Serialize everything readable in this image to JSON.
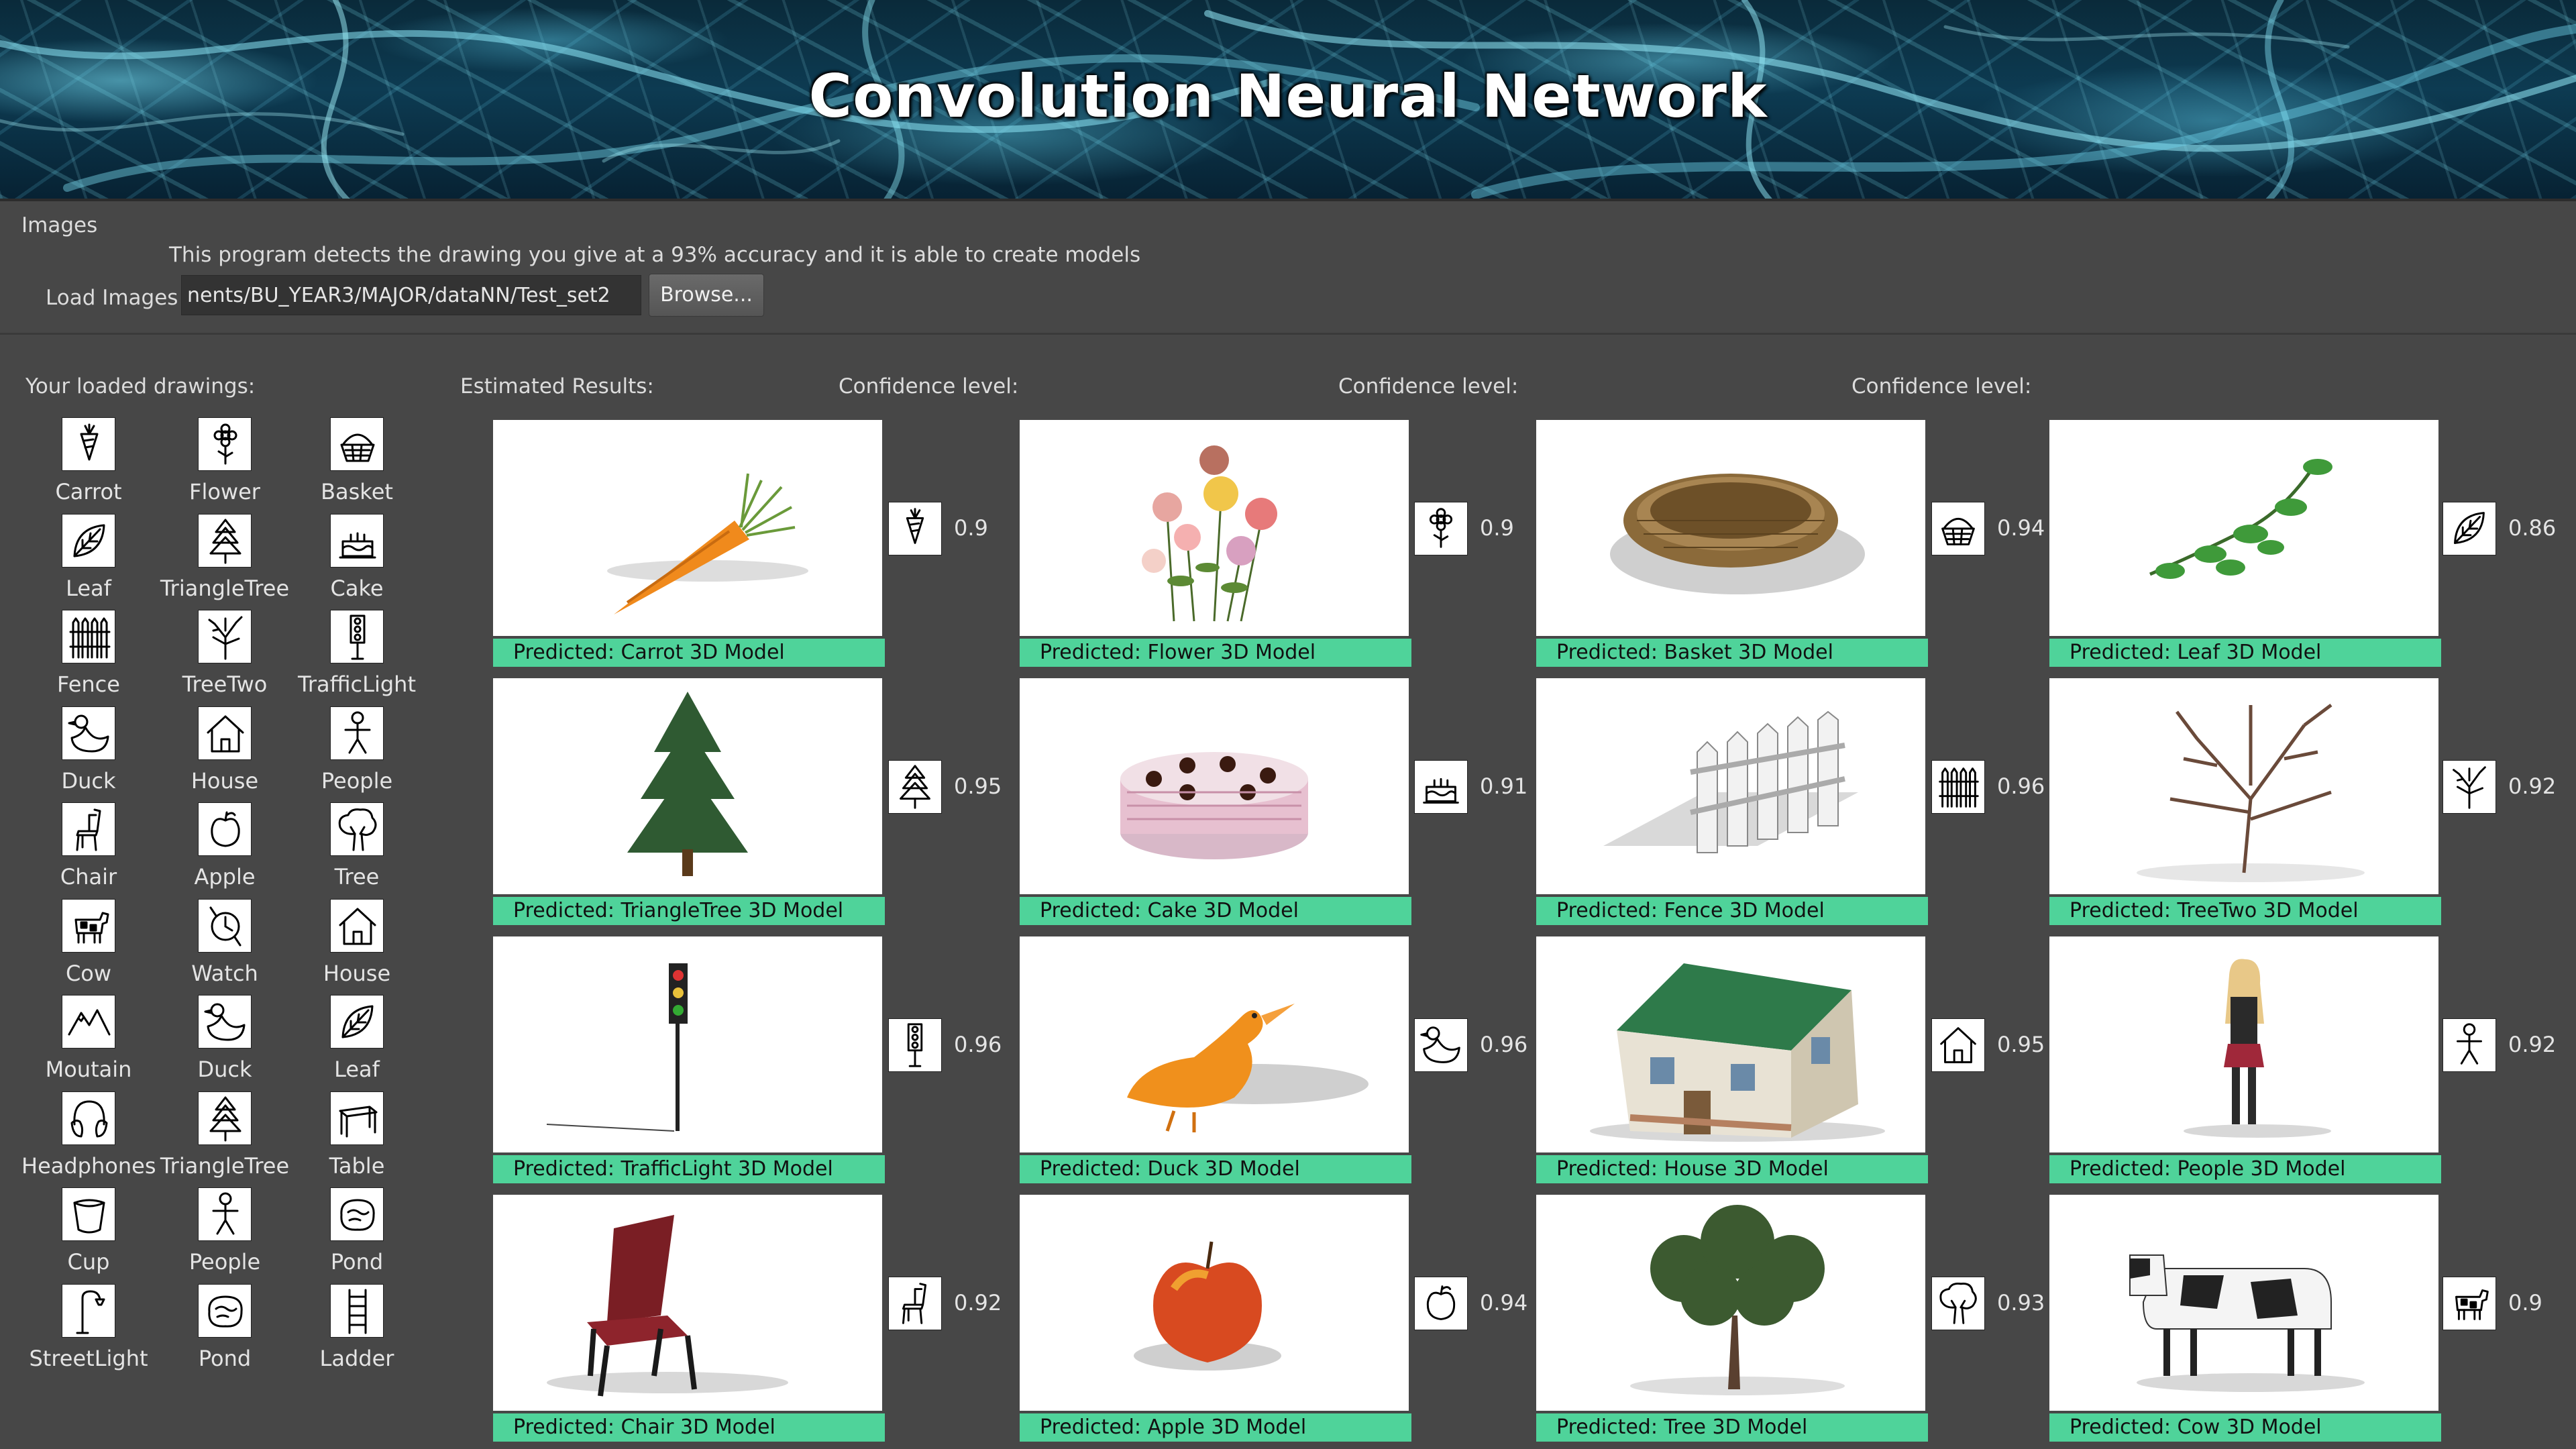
{
  "banner": {
    "title": "Convolution Neural Network"
  },
  "panel": {
    "images_label": "Images",
    "description": "This program detects the drawing you give at a 93% accuracy and it is able to create models",
    "load_label": "Load Images",
    "path_value": "nents/BU_YEAR3/MAJOR/dataNN/Test_set2",
    "browse_label": "Browse..."
  },
  "headers": {
    "drawings": "Your loaded drawings:",
    "results": "Estimated Results:",
    "confidence1": "Confidence level:",
    "confidence2": "Confidence level:",
    "confidence3": "Confidence level:"
  },
  "drawings": [
    {
      "label": "Carrot",
      "icon": "carrot-sketch-icon"
    },
    {
      "label": "Flower",
      "icon": "flower-sketch-icon"
    },
    {
      "label": "Basket",
      "icon": "basket-sketch-icon"
    },
    {
      "label": "Leaf",
      "icon": "leaf-sketch-icon"
    },
    {
      "label": "TriangleTree",
      "icon": "triangle-tree-sketch-icon"
    },
    {
      "label": "Cake",
      "icon": "cake-sketch-icon"
    },
    {
      "label": "Fence",
      "icon": "fence-sketch-icon"
    },
    {
      "label": "TreeTwo",
      "icon": "tree-two-sketch-icon"
    },
    {
      "label": "TrafficLight",
      "icon": "traffic-light-sketch-icon"
    },
    {
      "label": "Duck",
      "icon": "duck-sketch-icon"
    },
    {
      "label": "House",
      "icon": "house-sketch-icon"
    },
    {
      "label": "People",
      "icon": "people-sketch-icon"
    },
    {
      "label": "Chair",
      "icon": "chair-sketch-icon"
    },
    {
      "label": "Apple",
      "icon": "apple-sketch-icon"
    },
    {
      "label": "Tree",
      "icon": "tree-sketch-icon"
    },
    {
      "label": "Cow",
      "icon": "cow-sketch-icon"
    },
    {
      "label": "Watch",
      "icon": "watch-sketch-icon"
    },
    {
      "label": "House",
      "icon": "house-sketch-icon"
    },
    {
      "label": "Moutain",
      "icon": "mountain-sketch-icon"
    },
    {
      "label": "Duck",
      "icon": "duck-sketch-icon"
    },
    {
      "label": "Leaf",
      "icon": "leaf-sketch-icon"
    },
    {
      "label": "Headphones",
      "icon": "headphones-sketch-icon"
    },
    {
      "label": "TriangleTree",
      "icon": "triangle-tree-sketch-icon"
    },
    {
      "label": "Table",
      "icon": "table-sketch-icon"
    },
    {
      "label": "Cup",
      "icon": "cup-sketch-icon"
    },
    {
      "label": "People",
      "icon": "people-sketch-icon"
    },
    {
      "label": "Pond",
      "icon": "pond-sketch-icon"
    },
    {
      "label": "StreetLight",
      "icon": "street-light-sketch-icon"
    },
    {
      "label": "Pond",
      "icon": "pond-sketch-icon"
    },
    {
      "label": "Ladder",
      "icon": "ladder-sketch-icon"
    }
  ],
  "results": [
    {
      "predicted": "Predicted:  Carrot 3D Model",
      "confidence": "0.9",
      "model": "carrot-model-image"
    },
    {
      "predicted": "Predicted:  Flower 3D Model",
      "confidence": "0.9",
      "model": "flower-model-image"
    },
    {
      "predicted": "Predicted:  Basket 3D Model",
      "confidence": "0.94",
      "model": "basket-model-image"
    },
    {
      "predicted": "Predicted:  Leaf 3D Model",
      "confidence": "0.86",
      "model": "leaf-model-image"
    },
    {
      "predicted": "Predicted:  TriangleTree 3D Model",
      "confidence": "0.95",
      "model": "triangle-tree-model-image"
    },
    {
      "predicted": "Predicted:  Cake 3D Model",
      "confidence": "0.91",
      "model": "cake-model-image"
    },
    {
      "predicted": "Predicted:  Fence 3D Model",
      "confidence": "0.96",
      "model": "fence-model-image"
    },
    {
      "predicted": "Predicted:  TreeTwo 3D Model",
      "confidence": "0.92",
      "model": "tree-two-model-image"
    },
    {
      "predicted": "Predicted:  TrafficLight 3D Model",
      "confidence": "0.96",
      "model": "traffic-light-model-image"
    },
    {
      "predicted": "Predicted:  Duck 3D Model",
      "confidence": "0.96",
      "model": "duck-model-image"
    },
    {
      "predicted": "Predicted:  House 3D Model",
      "confidence": "0.95",
      "model": "house-model-image"
    },
    {
      "predicted": "Predicted:  People 3D Model",
      "confidence": "0.92",
      "model": "people-model-image"
    },
    {
      "predicted": "Predicted:  Chair 3D Model",
      "confidence": "0.92",
      "model": "chair-model-image"
    },
    {
      "predicted": "Predicted:  Apple 3D Model",
      "confidence": "0.94",
      "model": "apple-model-image"
    },
    {
      "predicted": "Predicted:  Tree 3D Model",
      "confidence": "0.93",
      "model": "tree-model-image"
    },
    {
      "predicted": "Predicted:  Cow 3D Model",
      "confidence": "0.9",
      "model": "cow-model-image"
    }
  ],
  "colors": {
    "prediction_bar": "#4fd39a",
    "background": "#474747",
    "banner": "#0d3b52"
  }
}
